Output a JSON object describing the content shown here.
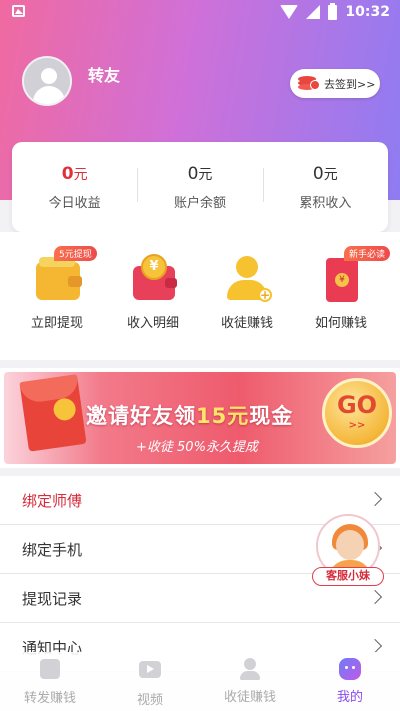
{
  "status_bar": {
    "time": "10:32"
  },
  "profile": {
    "username": "转友",
    "checkin_label": "去签到>>"
  },
  "balance": [
    {
      "value": "0",
      "unit": "元",
      "label": "今日收益",
      "highlight": true
    },
    {
      "value": "0",
      "unit": "元",
      "label": "账户余额",
      "highlight": false
    },
    {
      "value": "0",
      "unit": "元",
      "label": "累积收入",
      "highlight": false
    }
  ],
  "quick_actions": [
    {
      "label": "立即提现",
      "badge": "5元提现",
      "icon": "wallet-icon"
    },
    {
      "label": "收入明细",
      "badge": "",
      "icon": "income-wallet-icon"
    },
    {
      "label": "收徒赚钱",
      "badge": "",
      "icon": "add-user-icon"
    },
    {
      "label": "如何赚钱",
      "badge": "新手必读",
      "icon": "red-envelope-icon"
    }
  ],
  "banner": {
    "title_prefix": "邀请好友领",
    "title_amount": "15元",
    "title_suffix": "现金",
    "subtitle": "+收徒 50%永久提成",
    "go_label": "GO",
    "go_arrows": ">>"
  },
  "menu": [
    {
      "label": "绑定师傅"
    },
    {
      "label": "绑定手机"
    },
    {
      "label": "提现记录"
    },
    {
      "label": "通知中心"
    }
  ],
  "service": {
    "label": "客服小妹"
  },
  "bottom_nav": [
    {
      "label": "转发赚钱",
      "icon": "document-icon",
      "active": false
    },
    {
      "label": "视频",
      "icon": "video-icon",
      "active": false
    },
    {
      "label": "收徒赚钱",
      "icon": "user-icon",
      "active": false
    },
    {
      "label": "我的",
      "icon": "me-icon",
      "active": true
    }
  ],
  "colors": {
    "accent_red": "#e0303a",
    "active_purple": "#8a4cf0"
  }
}
